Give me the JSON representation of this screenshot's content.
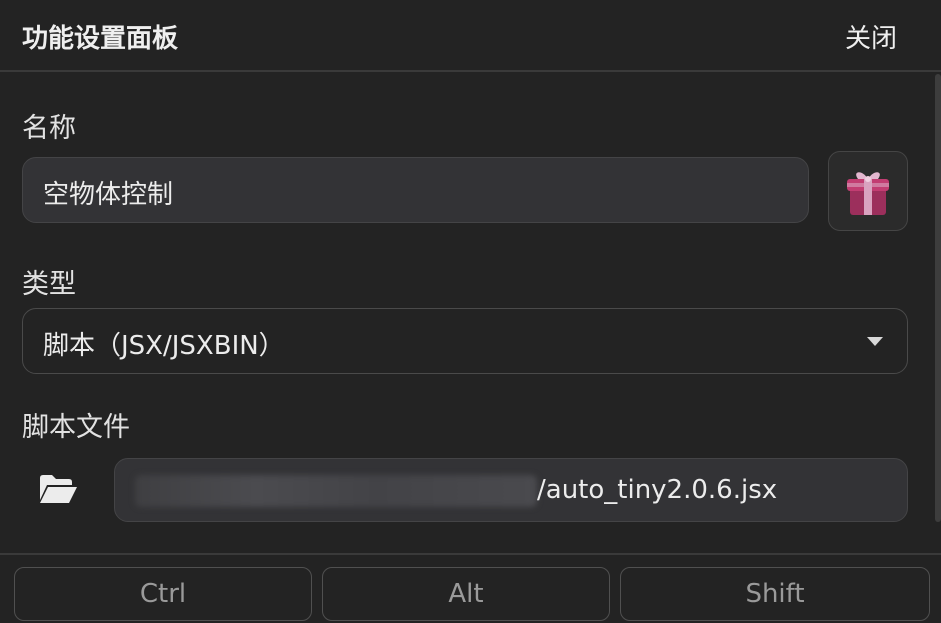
{
  "header": {
    "title": "功能设置面板",
    "close_label": "关闭"
  },
  "name": {
    "label": "名称",
    "value": "空物体控制",
    "icon": "gift-icon"
  },
  "type": {
    "label": "类型",
    "selected": "脚本（JSX/JSXBIN）"
  },
  "script_file": {
    "label": "脚本文件",
    "icon": "folder-open-icon",
    "path_visible": "/auto_tiny2.0.6.jsx"
  },
  "modifiers": {
    "ctrl": "Ctrl",
    "alt": "Alt",
    "shift": "Shift"
  }
}
